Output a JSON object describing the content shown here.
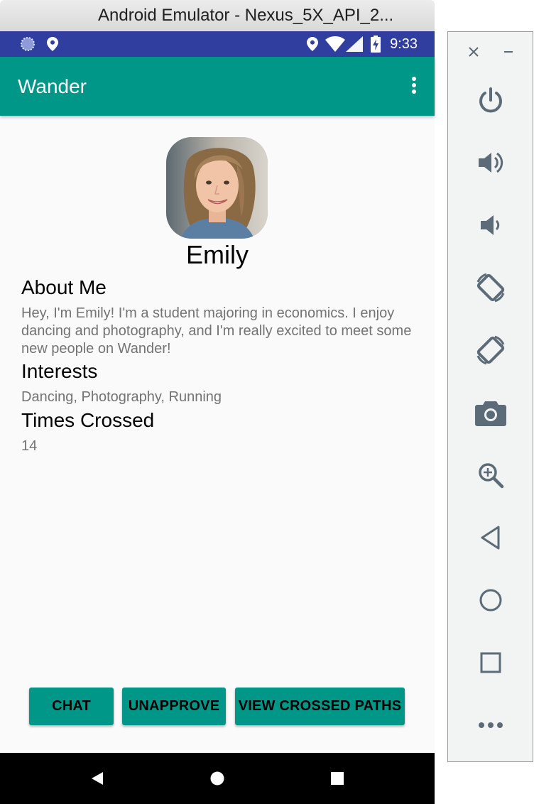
{
  "window": {
    "title": "Android Emulator - Nexus_5X_API_2..."
  },
  "status_bar": {
    "time": "9:33",
    "icons": [
      "sync-icon",
      "location-icon",
      "location-icon",
      "wifi-icon",
      "signal-icon",
      "battery-charging-icon"
    ]
  },
  "app_bar": {
    "title": "Wander",
    "menu_icon": "more-vert-icon"
  },
  "profile": {
    "name": "Emily",
    "about_heading": "About Me",
    "about_text": "Hey, I'm Emily! I'm a student majoring in economics. I enjoy dancing and photography, and I'm really excited to meet some new people on Wander!",
    "interests_heading": "Interests",
    "interests_text": "Dancing, Photography, Running",
    "times_crossed_heading": "Times Crossed",
    "times_crossed_value": "14"
  },
  "actions": {
    "chat": "CHAT",
    "unapprove": "UNAPPROVE",
    "view_crossed_paths": "VIEW CROSSED PATHS"
  },
  "nav_bar": [
    "back-icon",
    "home-icon",
    "recents-icon"
  ],
  "emulator_toolbar": {
    "controls": [
      "close-icon",
      "minimize-icon"
    ],
    "buttons": [
      "power-icon",
      "volume-up-icon",
      "volume-down-icon",
      "rotate-left-icon",
      "rotate-right-icon",
      "camera-icon",
      "zoom-icon",
      "back-icon",
      "home-icon",
      "overview-icon",
      "more-icon"
    ]
  },
  "colors": {
    "primary": "#009688",
    "status_bar": "#303f9f",
    "toolbar_icon": "#5b6b78"
  }
}
